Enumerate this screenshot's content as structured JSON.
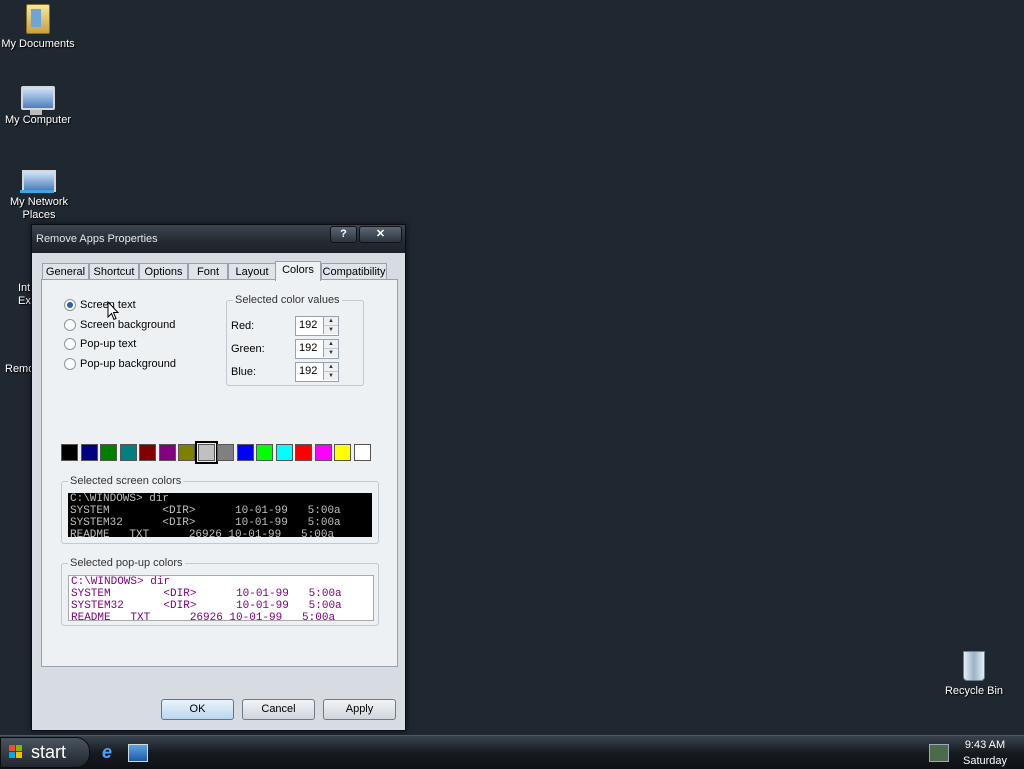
{
  "desktop": {
    "icons": [
      {
        "label": "My Documents"
      },
      {
        "label": "My Computer"
      },
      {
        "label": "My Network Places"
      },
      {
        "label": "Recycle Bin"
      }
    ],
    "partial_labels": {
      "ie_1": "Int",
      "ie_2": "Ex",
      "remove": "Remo"
    }
  },
  "dialog": {
    "title": "Remove Apps Properties",
    "help_glyph": "?",
    "close_glyph": "✕",
    "tabs": [
      "General",
      "Shortcut",
      "Options",
      "Font",
      "Layout",
      "Colors",
      "Compatibility"
    ],
    "active_tab": "Colors",
    "radios": [
      {
        "label": "Screen text",
        "checked": true
      },
      {
        "label": "Screen background",
        "checked": false
      },
      {
        "label": "Pop-up text",
        "checked": false
      },
      {
        "label": "Pop-up background",
        "checked": false
      }
    ],
    "color_values": {
      "title": "Selected color values",
      "red_label": "Red:",
      "red": "192",
      "green_label": "Green:",
      "green": "192",
      "blue_label": "Blue:",
      "blue": "192"
    },
    "palette": [
      "#000000",
      "#000080",
      "#008000",
      "#008080",
      "#800000",
      "#800080",
      "#808000",
      "#c0c0c0",
      "#808080",
      "#0000ff",
      "#00ff00",
      "#00ffff",
      "#ff0000",
      "#ff00ff",
      "#ffff00",
      "#ffffff"
    ],
    "selected_swatch_index": 7,
    "screen_colors": {
      "title": "Selected screen colors",
      "text": "C:\\WINDOWS> dir\nSYSTEM        <DIR>      10-01-99   5:00a\nSYSTEM32      <DIR>      10-01-99   5:00a\nREADME   TXT      26926 10-01-99   5:00a"
    },
    "popup_colors": {
      "title": "Selected pop-up colors",
      "text": "C:\\WINDOWS> dir\nSYSTEM        <DIR>      10-01-99   5:00a\nSYSTEM32      <DIR>      10-01-99   5:00a\nREADME   TXT      26926 10-01-99   5:00a"
    },
    "buttons": {
      "ok": "OK",
      "cancel": "Cancel",
      "apply": "Apply"
    }
  },
  "taskbar": {
    "start_label": "start",
    "time": "9:43 AM",
    "day": "Saturday"
  }
}
